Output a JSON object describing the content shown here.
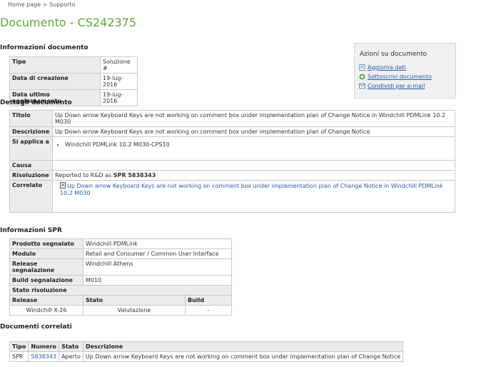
{
  "breadcrumb": {
    "home": "Home page",
    "sep": ">",
    "current": "Supporto"
  },
  "title": "Documento - CS242375",
  "doc_info": {
    "heading": "Informazioni documento",
    "rows": [
      {
        "label": "Tipo",
        "value": "Soluzione #"
      },
      {
        "label": "Data di creazione",
        "value": "19-lug-2016"
      },
      {
        "label": "Data ultimo aggiornamento",
        "value": "19-lug-2016"
      }
    ]
  },
  "actions": {
    "heading": "Azioni su documento",
    "items": [
      {
        "label": "Aggiorna dati",
        "icon": "refresh-icon"
      },
      {
        "label": "Sottoscrivi documento",
        "icon": "subscribe-icon"
      },
      {
        "label": "Condividi per e-mail",
        "icon": "mail-icon"
      }
    ]
  },
  "details": {
    "heading": "Dettagli documento",
    "titolo_label": "Titolo",
    "titolo_value": "Up Down arrow Keyboard Keys are not working on comment box under implementation plan of Change Notice in Windchill PDMLink 10.2 M030",
    "descrizione_label": "Descrizione",
    "descrizione_value": "Up Down arrow Keyboard Keys are not working on comment box under implementation plan of Change Notice",
    "applica_label": "Si applica a",
    "applica_item": "Windchill PDMLink 10.2 M030-CPS10",
    "causa_label": "Causa",
    "causa_value": "",
    "risoluzione_label": "Risoluzione",
    "risoluzione_prefix": "Reported to R&D as ",
    "risoluzione_spr": "SPR 5838343",
    "correlato_label": "Correlato",
    "correlato_link": "Up Down arrow Keyboard Keys are not working on comment box under implementation plan of Change Notice in Windchill PDMLink 10.2 M030"
  },
  "spr": {
    "heading": "Informazioni SPR",
    "rows": [
      {
        "label": "Prodotto segnalato",
        "value": "Windchill PDMLink"
      },
      {
        "label": "Modulo",
        "value": "Retail and Consumer / Common User Interface"
      },
      {
        "label": "Release segnalazione",
        "value": "Windchill Athens"
      },
      {
        "label": "Build segnalazione",
        "value": "M010"
      }
    ],
    "stato_label": "Stato risoluzione",
    "col_release": "Release",
    "col_stato": "Stato",
    "col_build": "Build",
    "res_release": "Windchill X-26",
    "res_stato": "Valutazione",
    "res_build": "-"
  },
  "related": {
    "heading": "Documenti correlati",
    "headers": [
      "Tipo",
      "Numero",
      "Stato",
      "Descrizione"
    ],
    "rows": [
      {
        "tipo": "SPR",
        "numero": "5838343",
        "stato": "Aperto",
        "descrizione": "Up Down arrow Keyboard Keys are not working on comment box under implementation plan of Change Notice"
      }
    ]
  },
  "colors": {
    "title": "#5aa83a",
    "link": "#2a5aa8"
  }
}
